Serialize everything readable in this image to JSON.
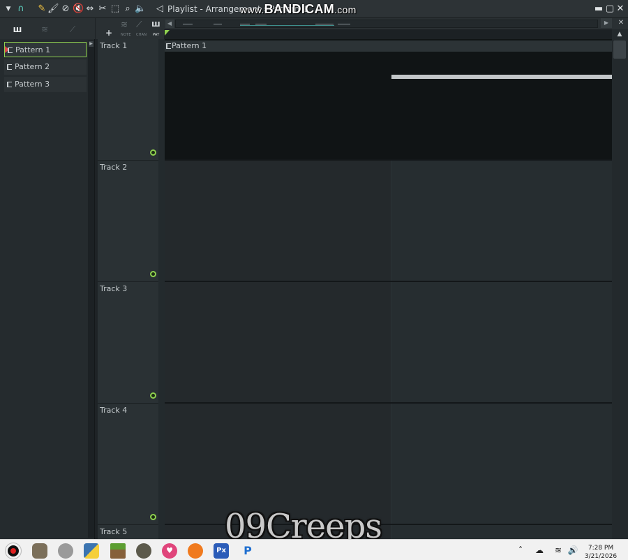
{
  "window": {
    "title": "Playlist - Arrangement › Pattern 1",
    "watermark_prefix": "www.",
    "watermark_brand": "BANDICAM",
    "watermark_suffix": ".com"
  },
  "toolbar": {
    "tools": [
      "menu-arrow-icon",
      "magnet-icon",
      "pencil-icon",
      "paint-brush-icon",
      "delete-icon",
      "mute-icon",
      "slip-icon",
      "slice-icon",
      "select-icon",
      "zoom-icon",
      "speaker-icon",
      "playback-icon"
    ]
  },
  "left_panel": {
    "tabs": [
      "piano-keys-icon",
      "audio-wave-icon",
      "automation-icon"
    ],
    "patterns": [
      {
        "label": "Pattern 1",
        "selected": true
      },
      {
        "label": "Pattern 2",
        "selected": false
      },
      {
        "label": "Pattern 3",
        "selected": false
      }
    ]
  },
  "playlist_toolbar": {
    "add_label": "+",
    "labels": {
      "audio": "NOTE",
      "automation": "CHAN",
      "pattern": "PAT"
    }
  },
  "tracks": [
    {
      "name": "Track 1",
      "clip": "Pattern 1"
    },
    {
      "name": "Track 2"
    },
    {
      "name": "Track 3"
    },
    {
      "name": "Track 4"
    },
    {
      "name": "Track 5"
    }
  ],
  "overlay": {
    "caption": "09Creeps"
  },
  "taskbar": {
    "time": "7:28 PM",
    "date": "3/21/2026",
    "apps": [
      "record-app",
      "gimp-app",
      "settings-app",
      "python-app",
      "minecraft-app",
      "rock-app",
      "heart-app",
      "fl-studio-app",
      "pixel-app",
      "pycharm-app"
    ],
    "colors": {
      "record": "#e02020",
      "fl": "#f07a1e",
      "pixel": "#2b5cb8",
      "heart": "#e0457b"
    }
  }
}
